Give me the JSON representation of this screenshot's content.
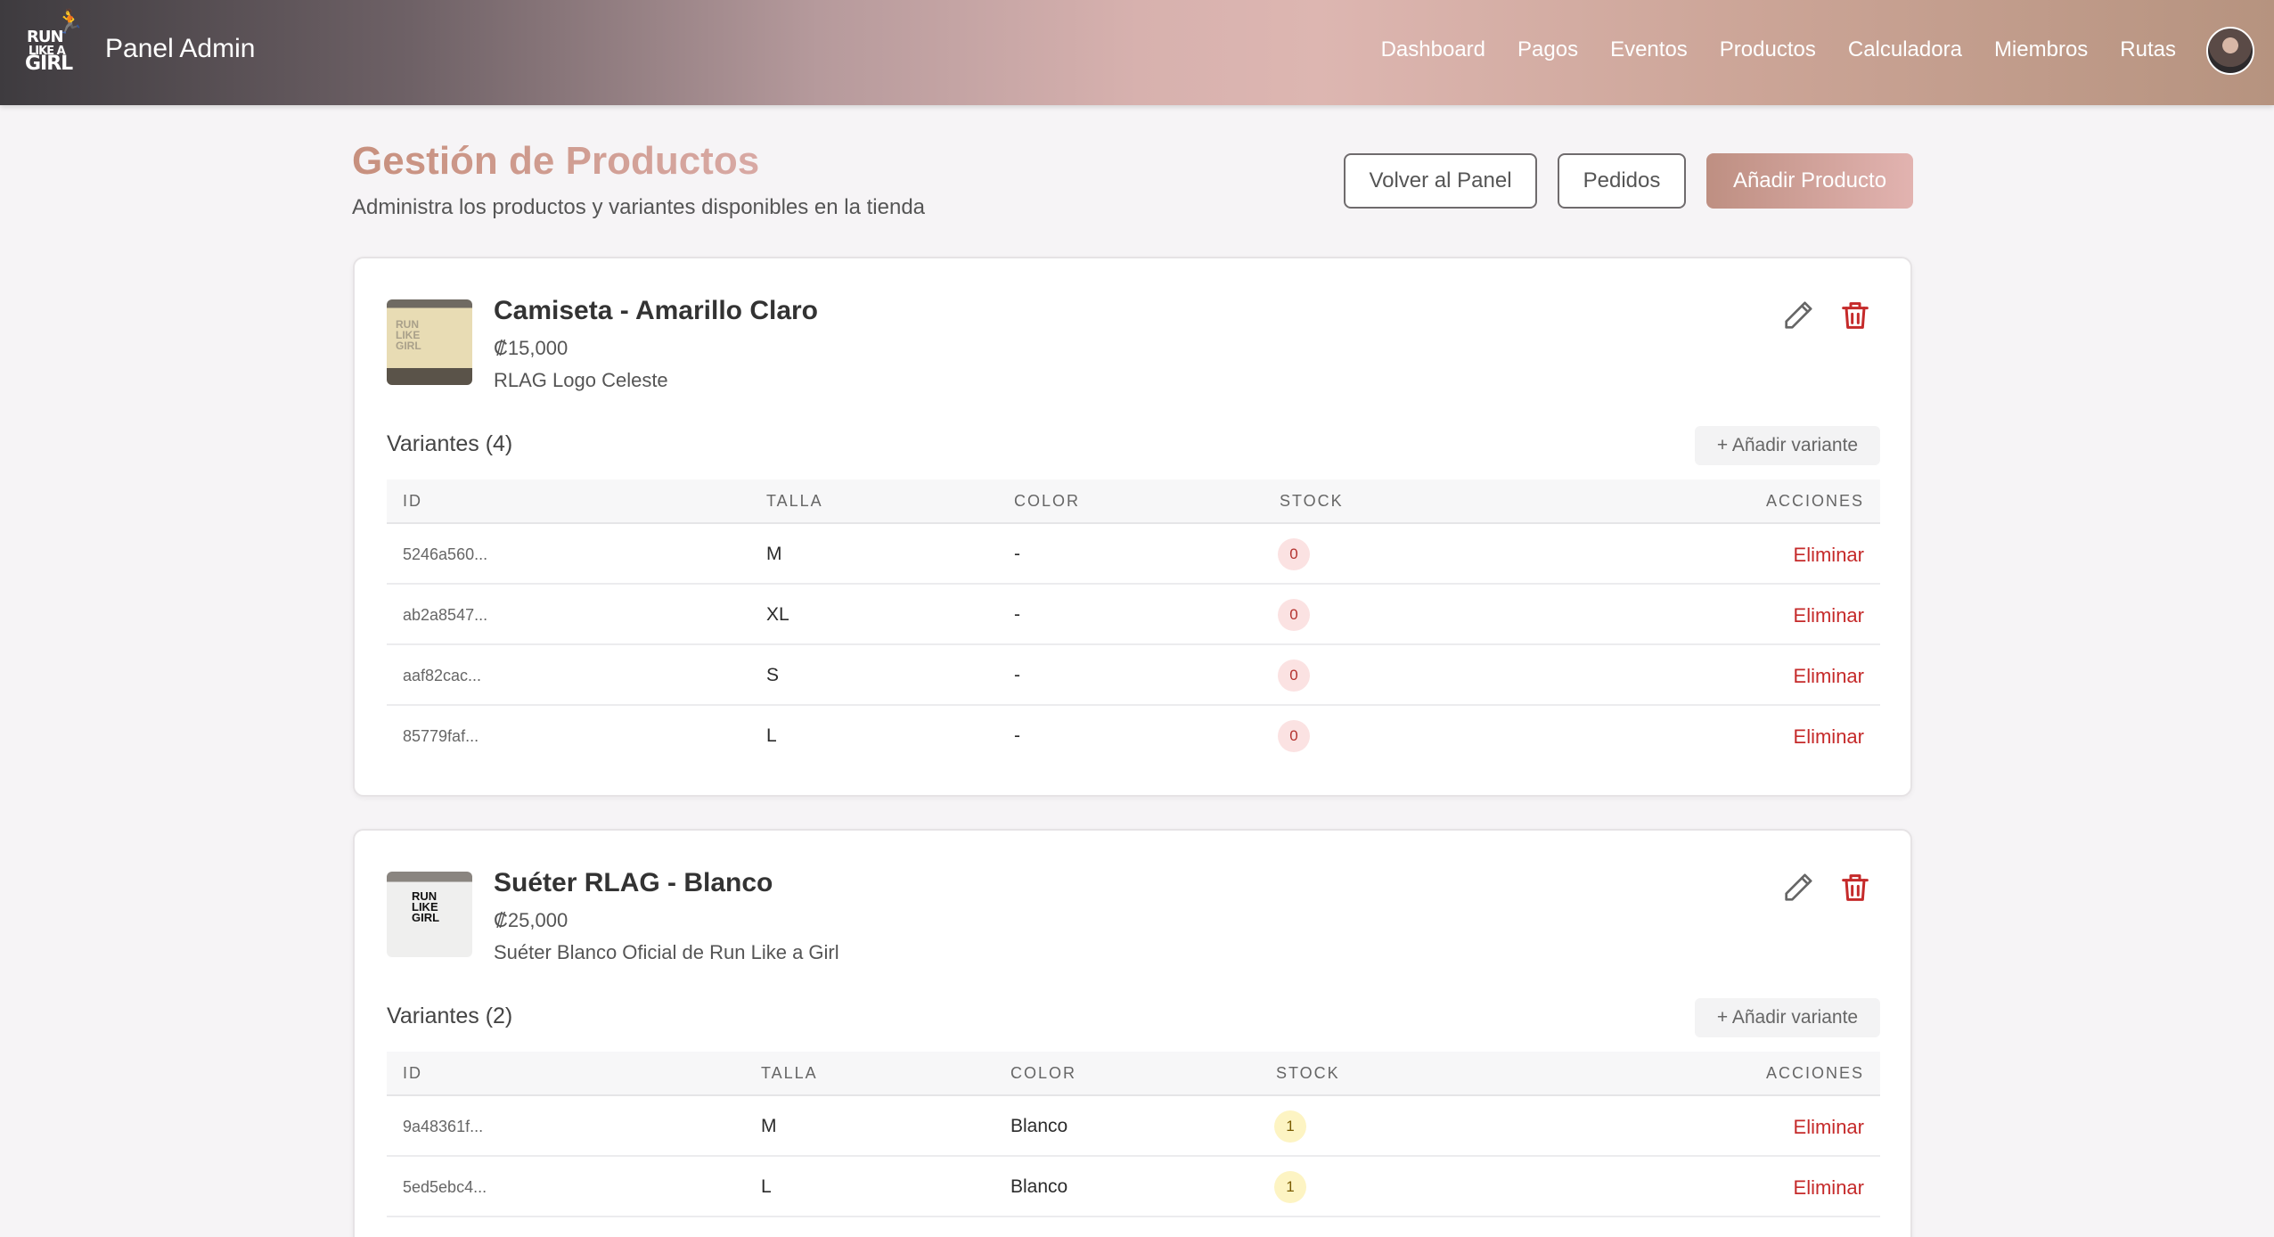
{
  "header": {
    "logo_lines": [
      "RUN",
      "LIKE A",
      "GIRL"
    ],
    "title": "Panel Admin",
    "nav": [
      "Dashboard",
      "Pagos",
      "Eventos",
      "Productos",
      "Calculadora",
      "Miembros",
      "Rutas"
    ]
  },
  "page": {
    "title": "Gestión de Productos",
    "subtitle": "Administra los productos y variantes disponibles en la tienda",
    "buttons": {
      "back": "Volver al Panel",
      "orders": "Pedidos",
      "add_product": "Añadir Producto"
    }
  },
  "products": [
    {
      "name": "Camiseta - Amarillo Claro",
      "price": "₡15,000",
      "description": "RLAG Logo Celeste",
      "variants_title": "Variantes (4)",
      "add_variant": "+ Añadir variante",
      "columns": [
        "ID",
        "TALLA",
        "COLOR",
        "STOCK",
        "ACCIONES"
      ],
      "rows": [
        {
          "id": "5246a560...",
          "size": "M",
          "color": "-",
          "stock": "0",
          "action": "Eliminar"
        },
        {
          "id": "ab2a8547...",
          "size": "XL",
          "color": "-",
          "stock": "0",
          "action": "Eliminar"
        },
        {
          "id": "aaf82cac...",
          "size": "S",
          "color": "-",
          "stock": "0",
          "action": "Eliminar"
        },
        {
          "id": "85779faf...",
          "size": "L",
          "color": "-",
          "stock": "0",
          "action": "Eliminar"
        }
      ]
    },
    {
      "name": "Suéter RLAG - Blanco",
      "price": "₡25,000",
      "description": "Suéter Blanco Oficial de Run Like a Girl",
      "variants_title": "Variantes (2)",
      "add_variant": "+ Añadir variante",
      "columns": [
        "ID",
        "TALLA",
        "COLOR",
        "STOCK",
        "ACCIONES"
      ],
      "rows": [
        {
          "id": "9a48361f...",
          "size": "M",
          "color": "Blanco",
          "stock": "1",
          "action": "Eliminar"
        },
        {
          "id": "5ed5ebc4...",
          "size": "L",
          "color": "Blanco",
          "stock": "1",
          "action": "Eliminar"
        }
      ]
    }
  ],
  "icons": {
    "edit": "pencil-icon",
    "delete": "trash-icon",
    "avatar": "user-avatar"
  },
  "colors": {
    "brand": "#c7907e",
    "danger": "#c52a2a"
  }
}
